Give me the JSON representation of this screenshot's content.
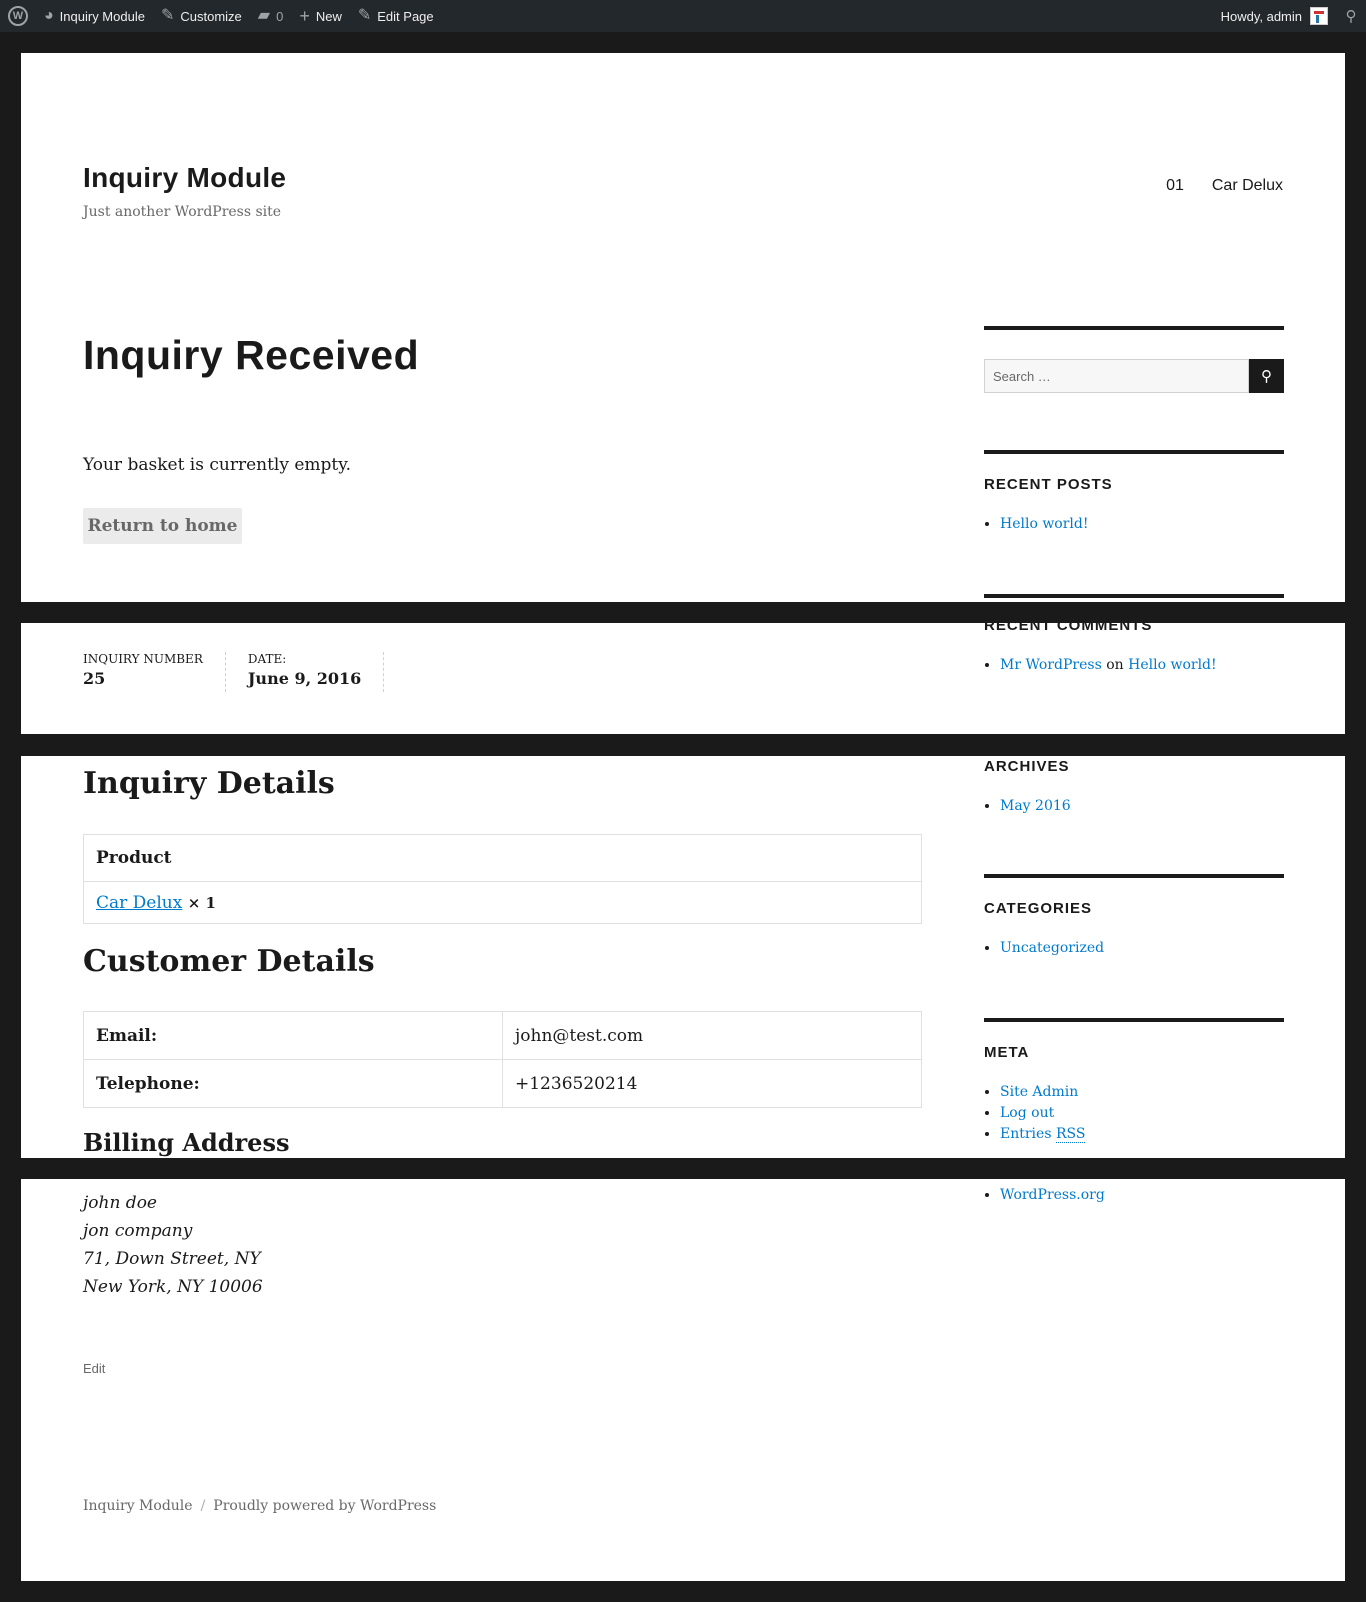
{
  "admin_bar": {
    "site_name": "Inquiry Module",
    "customize": "Customize",
    "comments_count": "0",
    "new": "New",
    "edit_page": "Edit Page",
    "howdy": "Howdy, admin"
  },
  "header": {
    "site_title": "Inquiry Module",
    "tagline": "Just another WordPress site",
    "nav": [
      "01",
      "Car Delux"
    ]
  },
  "main": {
    "page_title": "Inquiry Received",
    "basket_message": "Your basket is currently empty.",
    "return_button": "Return to home",
    "overview": {
      "number_label": "INQUIRY NUMBER",
      "number_value": "25",
      "date_label": "DATE:",
      "date_value": "June 9, 2016"
    },
    "inquiry_details_heading": "Inquiry Details",
    "product_header": "Product",
    "product_name": "Car Delux",
    "product_qty": "× 1",
    "customer_details_heading": "Customer Details",
    "customer": {
      "email_label": "Email:",
      "email_value": "john@test.com",
      "phone_label": "Telephone:",
      "phone_value": "+1236520214"
    },
    "billing_heading": "Billing Address",
    "billing_address": [
      "john doe",
      "jon company",
      "71, Down Street, NY",
      "New York, NY 10006"
    ],
    "edit_link": "Edit"
  },
  "sidebar": {
    "search_placeholder": "Search …",
    "recent_posts_title": "RECENT POSTS",
    "recent_posts": [
      "Hello world!"
    ],
    "recent_comments_title": "RECENT COMMENTS",
    "recent_comment": {
      "author": "Mr WordPress",
      "on": "on",
      "post": "Hello world!"
    },
    "archives_title": "ARCHIVES",
    "archives": [
      "May 2016"
    ],
    "categories_title": "CATEGORIES",
    "categories": [
      "Uncategorized"
    ],
    "meta_title": "META",
    "meta": {
      "site_admin": "Site Admin",
      "log_out": "Log out",
      "entries": "Entries",
      "rss": "RSS",
      "wordpress_org": "WordPress.org"
    }
  },
  "footer": {
    "site_name": "Inquiry Module",
    "separator": "/",
    "powered_by": "Proudly powered by WordPress"
  }
}
